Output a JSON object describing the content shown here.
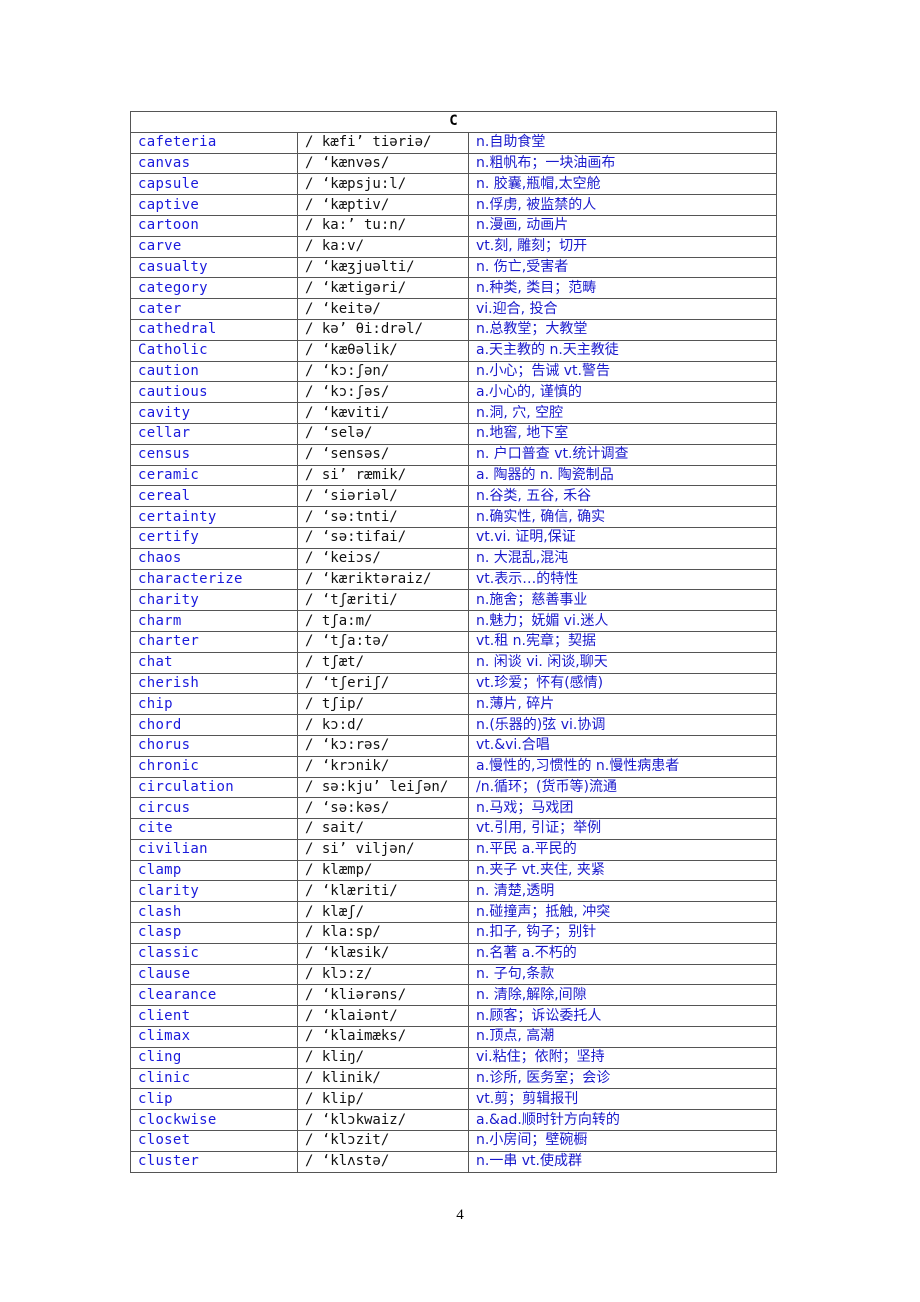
{
  "section": {
    "letter": "C"
  },
  "entries": [
    {
      "word": "cafeteria",
      "phonetic": "/ kæfi’ tiəriə/",
      "definition": "n.自助食堂"
    },
    {
      "word": "canvas",
      "phonetic": "/   ‘kænvəs/",
      "definition": "n.粗帆布；一块油画布"
    },
    {
      "word": "capsule",
      "phonetic": "/   ‘kæpsju:l/",
      "definition": "n. 胶囊,瓶帽,太空舱"
    },
    {
      "word": "captive",
      "phonetic": "/   ‘kæptiv/",
      "definition": "n.俘虏, 被监禁的人"
    },
    {
      "word": "cartoon",
      "phonetic": "/ ka:’ tu:n/",
      "definition": "n.漫画, 动画片"
    },
    {
      "word": "carve",
      "phonetic": "/ ka:v/",
      "definition": "vt.刻, 雕刻；切开"
    },
    {
      "word": "casualty",
      "phonetic": "/   ‘kæʒjuəlti/",
      "definition": "n. 伤亡,受害者"
    },
    {
      "word": "category",
      "phonetic": "/   ‘kætigəri/",
      "definition": "n.种类, 类目；范畴"
    },
    {
      "word": "cater",
      "phonetic": "/   ‘keitə/",
      "definition": "vi.迎合, 投合"
    },
    {
      "word": "cathedral",
      "phonetic": "/ kə’ θi:drəl/",
      "definition": "n.总教堂；大教堂"
    },
    {
      "word": "Catholic",
      "phonetic": "/   ‘kæθəlik/",
      "definition": "a.天主教的 n.天主教徒"
    },
    {
      "word": "caution",
      "phonetic": "/   ‘kɔ:ʃən/",
      "definition": "n.小心；告诫 vt.警告"
    },
    {
      "word": "cautious",
      "phonetic": "/   ‘kɔ:ʃəs/",
      "definition": "a.小心的, 谨慎的"
    },
    {
      "word": "cavity",
      "phonetic": "/   ‘kæviti/",
      "definition": "n.洞, 穴, 空腔"
    },
    {
      "word": "cellar",
      "phonetic": "/   ‘selə/",
      "definition": "n.地窖, 地下室"
    },
    {
      "word": "census",
      "phonetic": "/   ‘sensəs/",
      "definition": "n. 户口普查 vt.统计调查"
    },
    {
      "word": "ceramic",
      "phonetic": "/ si’ ræmik/",
      "definition": "a. 陶器的 n. 陶瓷制品"
    },
    {
      "word": "cereal",
      "phonetic": "/   ‘siəriəl/",
      "definition": "n.谷类, 五谷, 禾谷"
    },
    {
      "word": "certainty",
      "phonetic": "/   ‘sə:tnti/",
      "definition": "n.确实性, 确信, 确实"
    },
    {
      "word": "certify",
      "phonetic": "/   ‘sə:tifai/",
      "definition": "vt.vi. 证明,保证"
    },
    {
      "word": "chaos",
      "phonetic": "/   ‘keiɔs/",
      "definition": "n. 大混乱,混沌"
    },
    {
      "word": "characterize",
      "phonetic": "/   ‘kæriktəraiz/",
      "definition": "vt.表示…的特性"
    },
    {
      "word": "charity",
      "phonetic": "/   ‘tʃæriti/",
      "definition": "n.施舍；慈善事业"
    },
    {
      "word": "charm",
      "phonetic": "/ tʃa:m/",
      "definition": "n.魅力；妩媚 vi.迷人"
    },
    {
      "word": "charter",
      "phonetic": "/   ‘tʃa:tə/",
      "definition": "vt.租 n.宪章；契据"
    },
    {
      "word": "chat",
      "phonetic": "/ tʃæt/",
      "definition": "n. 闲谈 vi. 闲谈,聊天"
    },
    {
      "word": "cherish",
      "phonetic": "/   ‘tʃeriʃ/",
      "definition": "vt.珍爱；怀有(感情)"
    },
    {
      "word": "chip",
      "phonetic": "/ tʃip/",
      "definition": "n.薄片, 碎片"
    },
    {
      "word": "chord",
      "phonetic": "/ kɔ:d/",
      "definition": "n.(乐器的)弦 vi.协调"
    },
    {
      "word": "chorus",
      "phonetic": "/   ‘kɔ:rəs/",
      "definition": "vt.&vi.合唱"
    },
    {
      "word": "chronic",
      "phonetic": "/   ‘krɔnik/",
      "definition": "a.慢性的,习惯性的 n.慢性病患者"
    },
    {
      "word": "circulation",
      "phonetic": "/ sə:kju’ leiʃən/",
      "definition": "/n.循环；(货币等)流通"
    },
    {
      "word": "circus",
      "phonetic": "/   ‘sə:kəs/",
      "definition": "n.马戏；马戏团"
    },
    {
      "word": "cite",
      "phonetic": "/ sait/",
      "definition": "vt.引用, 引证；举例"
    },
    {
      "word": "civilian",
      "phonetic": "/ si’ viljən/",
      "definition": "n.平民 a.平民的"
    },
    {
      "word": "clamp",
      "phonetic": "/ klæmp/",
      "definition": "n.夹子 vt.夹住, 夹紧"
    },
    {
      "word": "clarity",
      "phonetic": "/   ‘klæriti/",
      "definition": "n. 清楚,透明"
    },
    {
      "word": "clash",
      "phonetic": "/ klæʃ/",
      "definition": "n.碰撞声；抵触, 冲突"
    },
    {
      "word": "clasp",
      "phonetic": "/ kla:sp/",
      "definition": "n.扣子, 钩子；别针"
    },
    {
      "word": "classic",
      "phonetic": "/   ‘klæsik/",
      "definition": "n.名著 a.不朽的"
    },
    {
      "word": "clause",
      "phonetic": "/ klɔ:z/",
      "definition": "n. 子句,条款"
    },
    {
      "word": "clearance",
      "phonetic": "/   ‘kliərəns/",
      "definition": "n. 清除,解除,间隙"
    },
    {
      "word": "client",
      "phonetic": "/   ‘klaiənt/",
      "definition": "n.顾客；诉讼委托人"
    },
    {
      "word": "climax",
      "phonetic": "/   ‘klaimæks/",
      "definition": "n.顶点, 高潮"
    },
    {
      "word": "cling",
      "phonetic": "/ kliŋ/",
      "definition": "vi.粘住；依附；坚持"
    },
    {
      "word": "clinic",
      "phonetic": "/ klinik/",
      "definition": "n.诊所, 医务室；会诊"
    },
    {
      "word": "clip",
      "phonetic": "/ klip/",
      "definition": "vt.剪；剪辑报刊"
    },
    {
      "word": "clockwise",
      "phonetic": "/   ‘klɔkwaiz/",
      "definition": "a.&ad.顺时针方向转的"
    },
    {
      "word": "closet",
      "phonetic": "/   ‘klɔzit/",
      "definition": "n.小房间；壁碗橱"
    },
    {
      "word": "cluster",
      "phonetic": "/   ‘klʌstə/",
      "definition": "n.一串 vt.使成群"
    }
  ],
  "footer": {
    "page_number": "4"
  },
  "colors": {
    "word": "#1a1adc",
    "definition": "#1a1acc",
    "phonetic": "#111111",
    "border": "#555555"
  }
}
